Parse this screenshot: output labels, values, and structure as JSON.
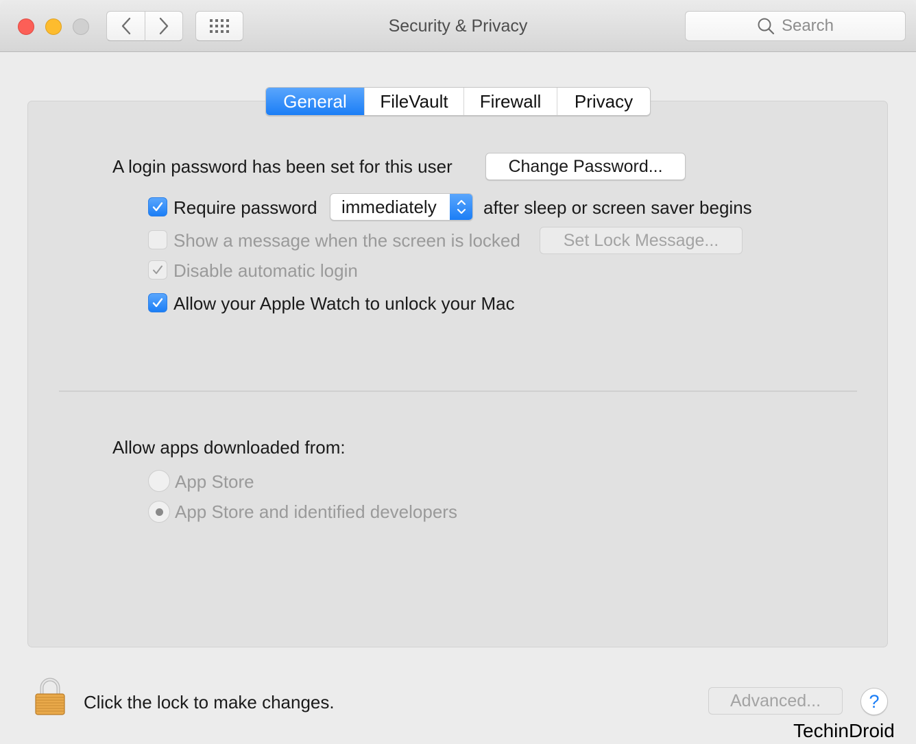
{
  "window": {
    "title": "Security & Privacy",
    "search_placeholder": "Search"
  },
  "tabs": [
    {
      "label": "General",
      "active": true
    },
    {
      "label": "FileVault",
      "active": false
    },
    {
      "label": "Firewall",
      "active": false
    },
    {
      "label": "Privacy",
      "active": false
    }
  ],
  "general": {
    "login_password_text": "A login password has been set for this user",
    "change_password_label": "Change Password...",
    "require_password": {
      "label": "Require password",
      "checked": true
    },
    "require_password_delay": "immediately",
    "require_password_suffix": "after sleep or screen saver begins",
    "show_message": {
      "label": "Show a message when the screen is locked",
      "checked": false,
      "enabled": false
    },
    "set_lock_message_label": "Set Lock Message...",
    "disable_auto_login": {
      "label": "Disable automatic login",
      "checked": true,
      "enabled": false
    },
    "apple_watch_unlock": {
      "label": "Allow your Apple Watch to unlock your Mac",
      "checked": true
    },
    "allow_apps_heading": "Allow apps downloaded from:",
    "allow_apps_options": [
      {
        "label": "App Store",
        "selected": false
      },
      {
        "label": "App Store and identified developers",
        "selected": true
      }
    ]
  },
  "footer": {
    "lock_text": "Click the lock to make changes.",
    "advanced_label": "Advanced...",
    "help_label": "?"
  },
  "watermark": "TechinDroid",
  "colors": {
    "accent": "#1b7ef6",
    "close": "#fc5f57",
    "minimize": "#fdbc2e",
    "zoom_disabled": "#d0d0d0"
  }
}
